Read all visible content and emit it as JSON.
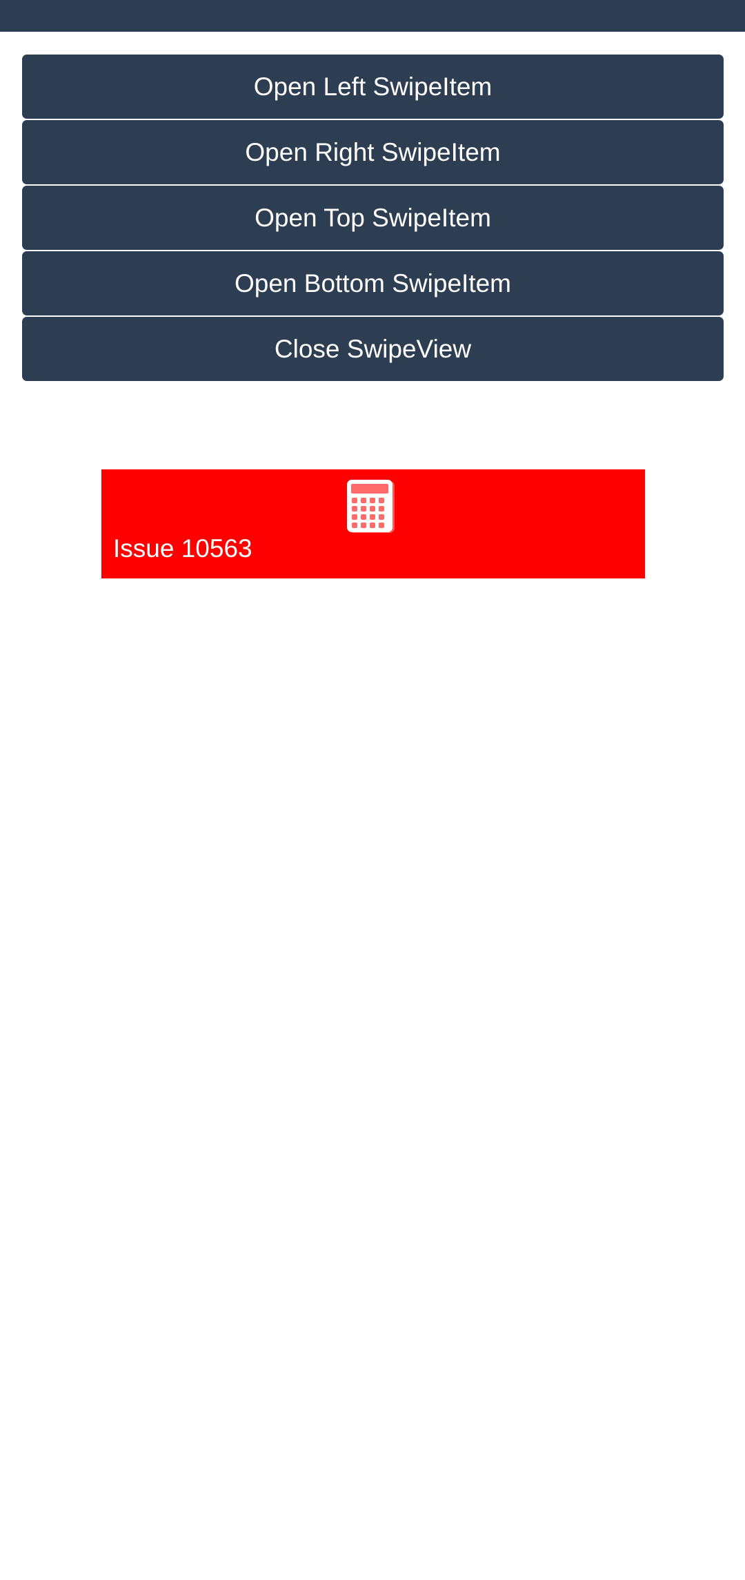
{
  "buttons": {
    "open_left": "Open Left SwipeItem",
    "open_right": "Open Right SwipeItem",
    "open_top": "Open Top SwipeItem",
    "open_bottom": "Open Bottom SwipeItem",
    "close": "Close SwipeView"
  },
  "swipe_item": {
    "label": "Issue 10563",
    "icon": "calculator-icon",
    "background": "#ff0000"
  },
  "colors": {
    "bar": "#2e3e52",
    "button_text": "#ffffff"
  }
}
